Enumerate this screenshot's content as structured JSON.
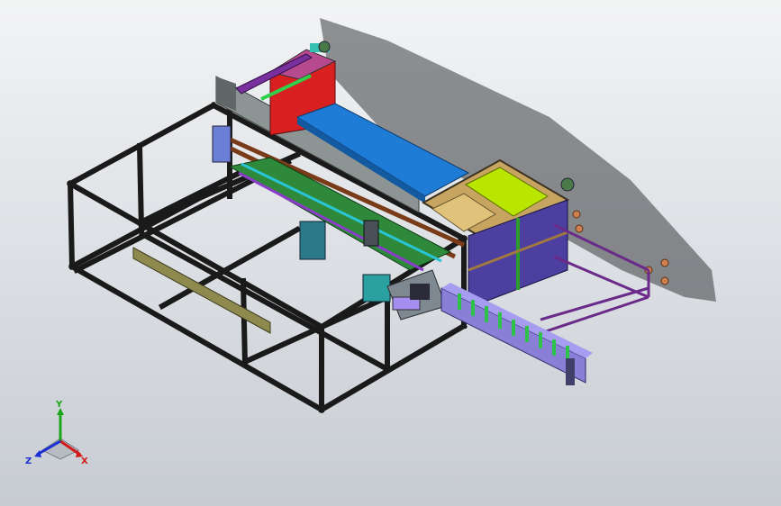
{
  "viewport": {
    "background_top": "#f3f4f5",
    "background_bottom": "#c7ccd2"
  },
  "model": {
    "frame_color": "#1a1a1a",
    "conveyor_color": "#1e7bd6",
    "red_panel_color": "#d92020",
    "green_rail_color": "#2e9e3c",
    "purple_color": "#6a2a8a",
    "lime_color": "#b9e600",
    "tan_color": "#e0c27a",
    "brown_rail_color": "#7a3b18",
    "gray_plate_color": "#8d9494",
    "olive_bar_color": "#8e8a4e",
    "lavender_color": "#8a7fd6"
  },
  "triad": {
    "x_label": "X",
    "y_label": "Y",
    "z_label": "Z",
    "x_color": "#d31818",
    "y_color": "#1aa51a",
    "z_color": "#1a2fd3"
  }
}
